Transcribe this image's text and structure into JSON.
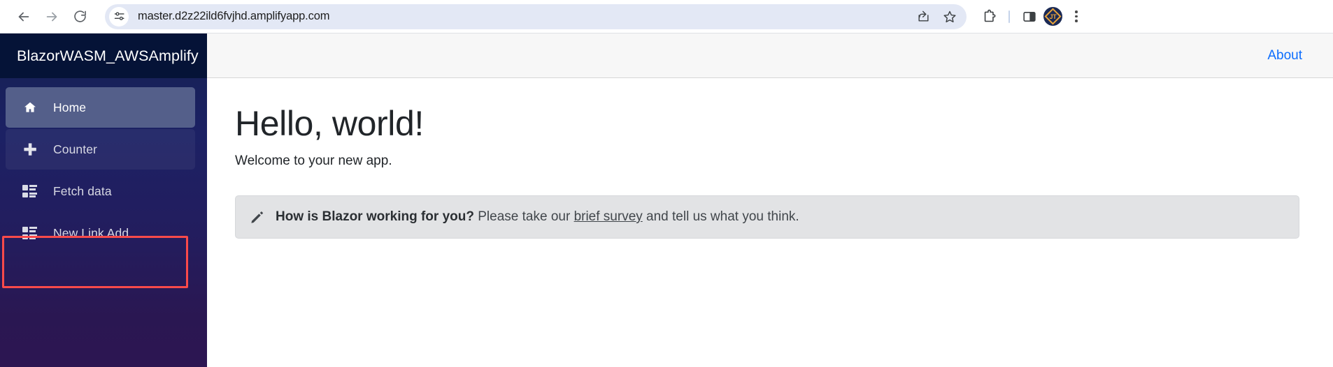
{
  "browser": {
    "back_label": "Back",
    "forward_label": "Forward",
    "reload_label": "Reload",
    "site_info_label": "View site information",
    "url": "master.d2z22ild6fvjhd.amplifyapp.com",
    "share_label": "Share this page",
    "bookmark_label": "Bookmark this tab",
    "extensions_label": "Extensions",
    "side_panel_label": "Side panel",
    "profile_initials": "JT",
    "menu_label": "Customize and control Google Chrome"
  },
  "app": {
    "brand": "BlazorWASM_AWSAmplify",
    "about_link": "About",
    "nav": [
      {
        "label": "Home",
        "icon": "home-icon",
        "state": "active"
      },
      {
        "label": "Counter",
        "icon": "plus-icon",
        "state": "soft"
      },
      {
        "label": "Fetch data",
        "icon": "list-icon",
        "state": "normal"
      },
      {
        "label": "New Link Add",
        "icon": "list-icon",
        "state": "normal"
      }
    ],
    "main": {
      "title": "Hello, world!",
      "welcome": "Welcome to your new app.",
      "alert": {
        "icon": "pencil-icon",
        "bold": "How is Blazor working for you?",
        "middle": " Please take our ",
        "link": "brief survey",
        "tail": " and tell us what you think."
      }
    }
  },
  "colors": {
    "brand_bg": "#051337",
    "sidebar_top": "#141c3d",
    "sidebar_bottom": "#2d1652",
    "nav_active": "#545f8a",
    "link_blue": "#0d6efd",
    "annotation_red": "#fb4a4a",
    "alert_bg": "#e2e3e5",
    "omnibox_bg": "#e3e8f5"
  }
}
